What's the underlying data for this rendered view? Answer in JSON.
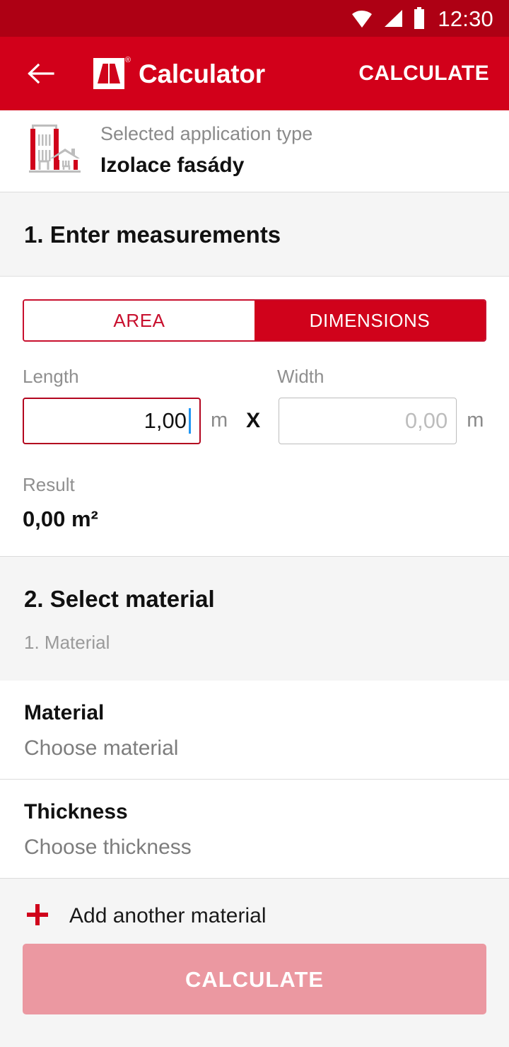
{
  "status_bar": {
    "time": "12:30",
    "icons": [
      "wifi-icon",
      "cellular-signal-icon",
      "battery-icon"
    ],
    "background_color": "#AE0014"
  },
  "app_bar": {
    "back_icon": "back-arrow-icon",
    "logo_icon": "rockwool-logo-icon",
    "title": "Calculator",
    "registered_mark": "®",
    "action_label": "CALCULATE",
    "background_color": "#D2001A"
  },
  "application_type": {
    "icon": "building-house-icon",
    "label": "Selected application type",
    "value": "Izolace fasády"
  },
  "section_measurements": {
    "title": "1. Enter measurements",
    "toggle": {
      "options": [
        {
          "label": "AREA",
          "selected": false
        },
        {
          "label": "DIMENSIONS",
          "selected": true
        }
      ],
      "selected_value": "DIMENSIONS",
      "accent_color": "#C8102E"
    },
    "length": {
      "label": "Length",
      "value": "1,00",
      "unit": "m",
      "focused": true,
      "border_color": "#B3061F",
      "caret_color": "#2196F3"
    },
    "separator": "X",
    "width": {
      "label": "Width",
      "value": "",
      "placeholder": "0,00",
      "unit": "m",
      "focused": false,
      "border_color": "#BDBDBD"
    },
    "result": {
      "label": "Result",
      "value": "0,00 m²"
    }
  },
  "section_material": {
    "title": "2. Select material",
    "subtitle": "1. Material",
    "rows": [
      {
        "title": "Material",
        "value": "Choose material"
      },
      {
        "title": "Thickness",
        "value": "Choose thickness"
      }
    ],
    "add_another": {
      "icon": "plus-icon",
      "label": "Add another material",
      "icon_color": "#D0021B"
    }
  },
  "bottom_action": {
    "label": "CALCULATE",
    "enabled": false,
    "background_color": "#EB98A1"
  }
}
